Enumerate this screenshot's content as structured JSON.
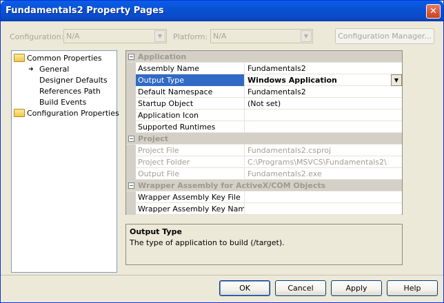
{
  "window": {
    "title": "Fundamentals2 Property Pages",
    "close_glyph": "✕"
  },
  "config_bar": {
    "configuration_label": "Configuration:",
    "configuration_value": "N/A",
    "platform_label": "Platform:",
    "platform_value": "N/A",
    "manager_button": "Configuration Manager..."
  },
  "tree": {
    "root1": "Common Properties",
    "children": [
      "General",
      "Designer Defaults",
      "References Path",
      "Build Events"
    ],
    "selected": "General",
    "root2": "Configuration Properties"
  },
  "grid": {
    "categories": [
      {
        "title": "Application",
        "rows": [
          {
            "name": "Assembly Name",
            "value": "Fundamentals2"
          },
          {
            "name": "Output Type",
            "value": "Windows Application",
            "selected": true
          },
          {
            "name": "Default Namespace",
            "value": "Fundamentals2"
          },
          {
            "name": "Startup Object",
            "value": "(Not set)"
          },
          {
            "name": "Application Icon",
            "value": ""
          },
          {
            "name": "Supported Runtimes",
            "value": ""
          }
        ]
      },
      {
        "title": "Project",
        "rows": [
          {
            "name": "Project File",
            "value": "Fundamentals2.csproj",
            "disabled": true
          },
          {
            "name": "Project Folder",
            "value": "C:\\Programs\\MSVCS\\Fundamentals2\\",
            "disabled": true
          },
          {
            "name": "Output File",
            "value": "Fundamentals2.exe",
            "disabled": true
          }
        ]
      },
      {
        "title": "Wrapper Assembly for ActiveX/COM Objects",
        "rows": [
          {
            "name": "Wrapper Assembly Key File",
            "value": ""
          },
          {
            "name": "Wrapper Assembly Key Name",
            "value": ""
          }
        ]
      }
    ]
  },
  "description": {
    "title": "Output Type",
    "text": "The type of application to build (/target)."
  },
  "buttons": {
    "ok": "OK",
    "cancel": "Cancel",
    "apply": "Apply",
    "help": "Help"
  },
  "colors": {
    "title_bar": "#0a5ee8",
    "selection": "#316ac5",
    "face": "#ece9d8"
  }
}
